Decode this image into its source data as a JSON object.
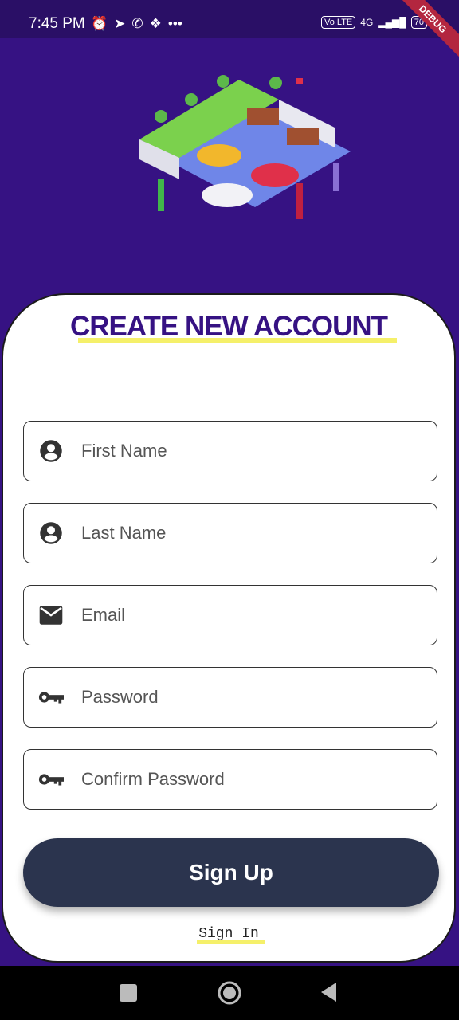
{
  "status_bar": {
    "time": "7:45 PM",
    "icons": [
      "alarm-icon",
      "telegram-icon",
      "whatsapp-icon",
      "chat-icon",
      "more-icon"
    ],
    "volte": "Vo LTE",
    "network": "4G",
    "battery": "70"
  },
  "debug_banner": "DEBUG",
  "form": {
    "title": "CREATE NEW ACCOUNT",
    "fields": [
      {
        "placeholder": "First Name",
        "icon": "account-circle-icon"
      },
      {
        "placeholder": "Last Name",
        "icon": "account-circle-icon"
      },
      {
        "placeholder": "Email",
        "icon": "mail-icon"
      },
      {
        "placeholder": "Password",
        "icon": "key-icon"
      },
      {
        "placeholder": "Confirm Password",
        "icon": "key-icon"
      }
    ],
    "signup_label": "Sign Up",
    "signin_label": "Sign In"
  },
  "colors": {
    "background": "#361283",
    "title": "#361283",
    "button": "#2b344e",
    "underline": "#f5f06a"
  }
}
